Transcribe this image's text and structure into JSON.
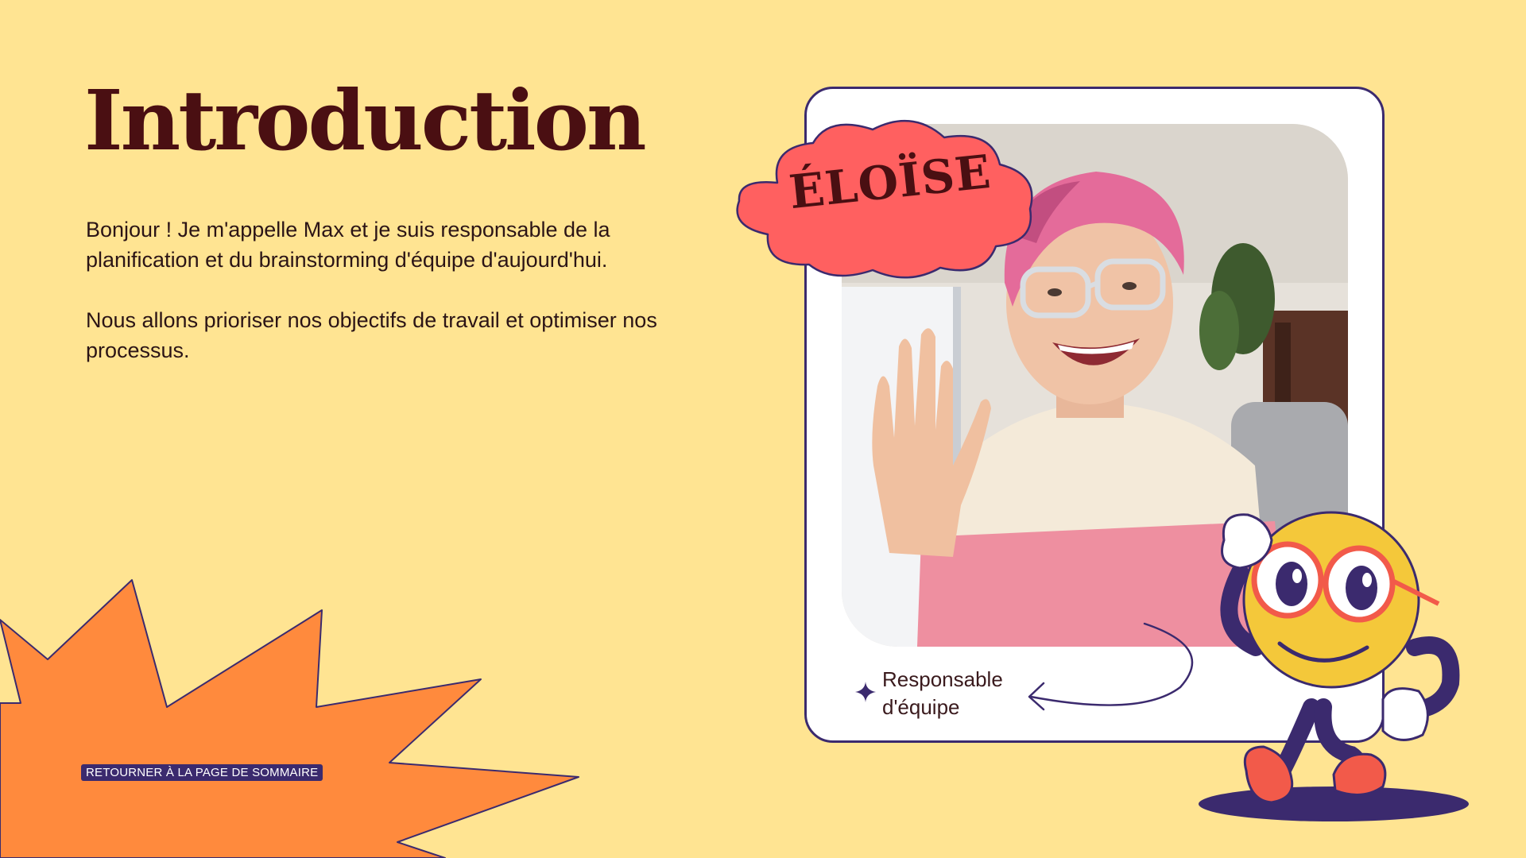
{
  "slide": {
    "title": "Introduction",
    "paragraphs": [
      "Bonjour ! Je m'appelle Max et je suis responsable de la planification et du brainstorming d'équipe d'aujourd'hui.",
      "Nous allons prioriser nos objectifs de travail et optimiser nos processus."
    ],
    "back_link_label": "RETOURNER À LA PAGE DE SOMMAIRE"
  },
  "profile_card": {
    "name_tag": "ÉLOÏSE",
    "caption": "Responsable d'équipe"
  },
  "colors": {
    "background": "#FFE492",
    "title": "#4A0F12",
    "starburst": "#FF8A3D",
    "outline": "#3B2A6E",
    "cloud": "#FF6060",
    "card": "#FFFFFF",
    "mascot_face": "#F4C83A"
  },
  "icons": {
    "caption_star": "sparkle-icon",
    "caption_arrow": "curved-arrow-icon"
  }
}
